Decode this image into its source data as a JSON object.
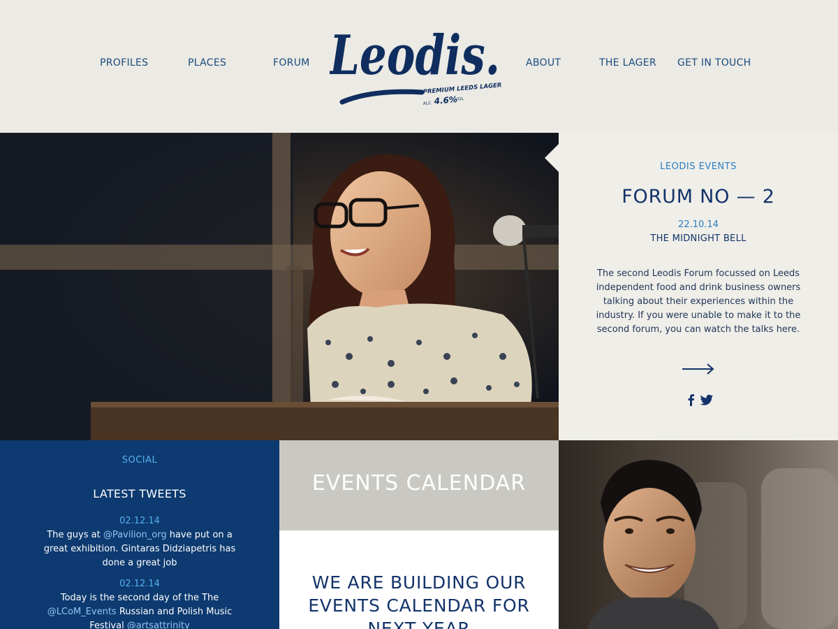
{
  "header": {
    "nav_left": [
      {
        "label": "PROFILES"
      },
      {
        "label": "PLACES"
      },
      {
        "label": "FORUM"
      }
    ],
    "nav_right": [
      {
        "label": "ABOUT"
      },
      {
        "label": "THE LAGER"
      },
      {
        "label": "GET IN TOUCH"
      }
    ],
    "logo": {
      "wordmark": "Leodis.",
      "tagline": "PREMIUM LEEDS LAGER",
      "alc_prefix": "ALC",
      "abv": "4.6%",
      "vol_suffix": "VOL"
    }
  },
  "featured_event": {
    "category": "LEODIS EVENTS",
    "title": "FORUM NO — 2",
    "date": "22.10.14",
    "venue": "THE MIDNIGHT BELL",
    "description": "The second Leodis Forum focussed on Leeds independent food and drink business owners talking about their experiences within the industry. If you were unable to make it to the second forum, you can watch the talks here.",
    "arrow_icon": "arrow-right-icon",
    "social_icons": [
      "facebook-icon",
      "twitter-icon"
    ]
  },
  "social": {
    "label": "SOCIAL",
    "heading": "LATEST TWEETS",
    "tweets": [
      {
        "date": "02.12.14",
        "text_before": "The guys at ",
        "mention": "@Pavilion_org",
        "text_after": " have put on a great exhibition. Gintaras Didziapetris has done a great job"
      },
      {
        "date": "02.12.14",
        "text_before": "Today is the second day of the The ",
        "mention": "@LCoM_Events",
        "text_after": " Russian and Polish Music Festival ",
        "mention2": "@artsattrinity"
      }
    ]
  },
  "calendar": {
    "title": "EVENTS CALENDAR",
    "message": "WE ARE BUILDING OUR EVENTS CALENDAR FOR NEXT YEAR"
  },
  "colors": {
    "header_bg": "#ebeae4",
    "navy": "#13336a",
    "link_blue": "#2d7ec2",
    "social_bg": "#0d3a70",
    "calendar_band": "#c9c8c2"
  }
}
